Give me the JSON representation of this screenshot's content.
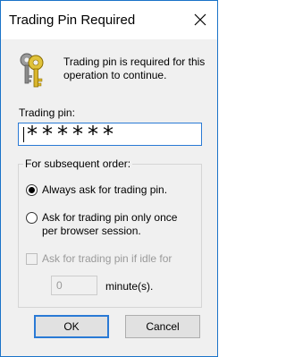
{
  "window": {
    "title": "Trading Pin Required",
    "close_icon": "close-icon"
  },
  "message": {
    "icon": "keys-icon",
    "text": "Trading pin is required for this operation to continue."
  },
  "pin": {
    "label": "Trading pin:",
    "value": "******"
  },
  "subsequent_order": {
    "legend": "For subsequent order:",
    "options": [
      {
        "label": "Always ask for trading pin.",
        "checked": true
      },
      {
        "label": "Ask for trading pin only once per browser session.",
        "checked": false
      }
    ],
    "idle_checkbox": {
      "label": "Ask for trading pin if idle for",
      "checked": false,
      "enabled": false
    },
    "minutes_value": "0",
    "minutes_unit": "minute(s)."
  },
  "buttons": {
    "ok": "OK",
    "cancel": "Cancel"
  },
  "colors": {
    "window_border": "#1a73c8",
    "focus_border": "#2a7ad5",
    "dialog_bg": "#f0f0f0",
    "disabled_text": "#9a9a9a"
  }
}
